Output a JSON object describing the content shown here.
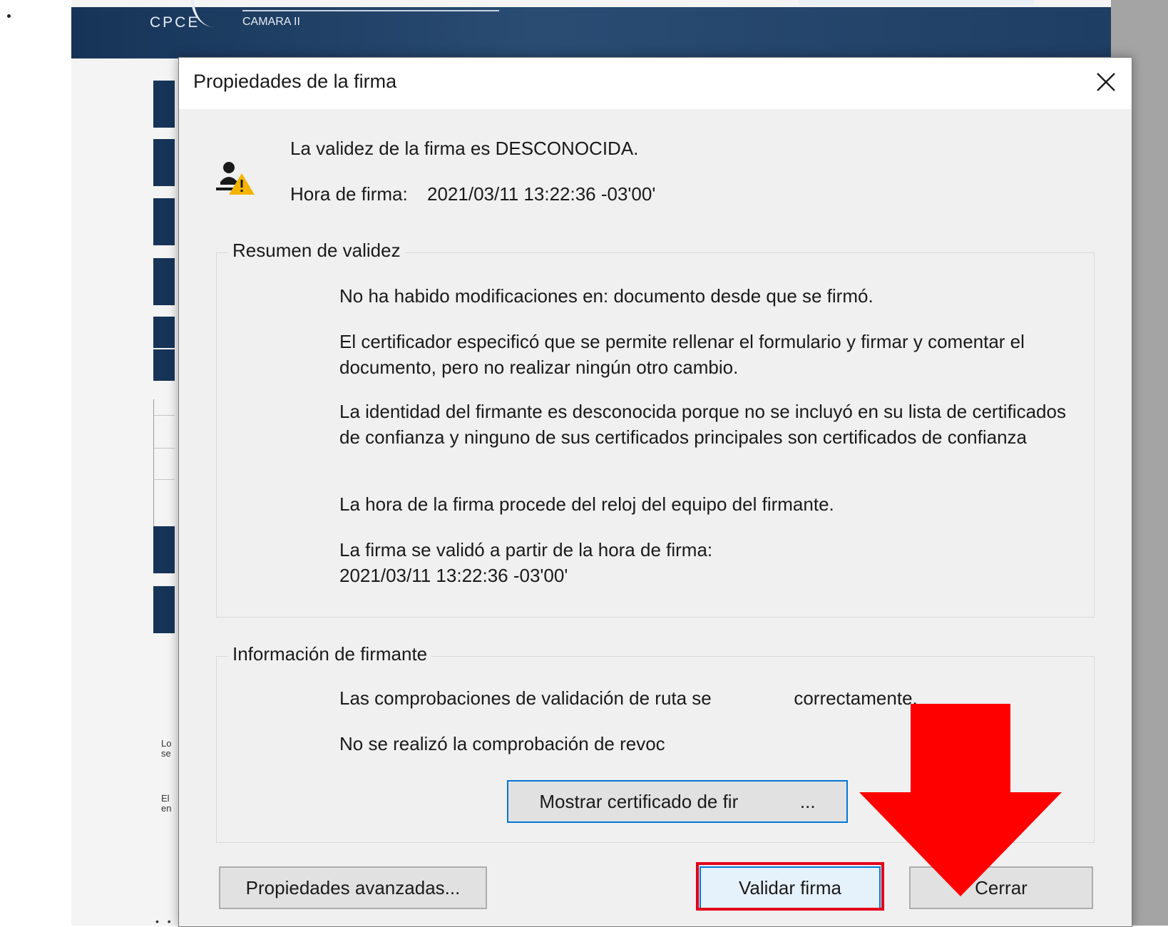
{
  "background": {
    "logo_text": "CPCE",
    "banner_subtitle": "CAMARA II",
    "fragments": [
      "Lo",
      "se",
      "El",
      "en"
    ],
    "dots": "• •"
  },
  "dialog": {
    "title": "Propiedades de la firma",
    "status_icon": "signature-warning-icon",
    "close_icon": "close-icon",
    "status_line": "La validez de la firma es DESCONOCIDA.",
    "signing_time_label": "Hora de firma:",
    "signing_time_value": "2021/03/11 13:22:36 -03'00'",
    "validity_summary": {
      "title": "Resumen de validez",
      "messages": [
        "No ha habido modificaciones en: documento desde que se firmó.",
        "El certificador especificó que se permite rellenar el formulario y firmar y comentar el documento, pero no realizar ningún otro cambio.",
        "La identidad del firmante es desconocida porque no se incluyó en su lista de certificados de confianza y ninguno de sus certificados principales son certificados de confianza",
        "La hora de la firma procede del reloj del equipo del firmante.",
        "La firma se validó a partir de la hora de firma:\n2021/03/11 13:22:36 -03'00'"
      ]
    },
    "signer_info": {
      "title": "Información de firmante",
      "messages": [
        "Las comprobaciones de validación de ruta se                correctamente.",
        "No se realizó la comprobación de revoc"
      ],
      "show_certificate_button": "Mostrar certificado de fir            ..."
    },
    "buttons": {
      "advanced": "Propiedades avanzadas...",
      "validate": "Validar firma",
      "close": "Cerrar"
    }
  },
  "colors": {
    "highlight": "#e3001b",
    "arrow": "#ff0000",
    "focus_border": "#0078d7",
    "banner": "#163458"
  }
}
